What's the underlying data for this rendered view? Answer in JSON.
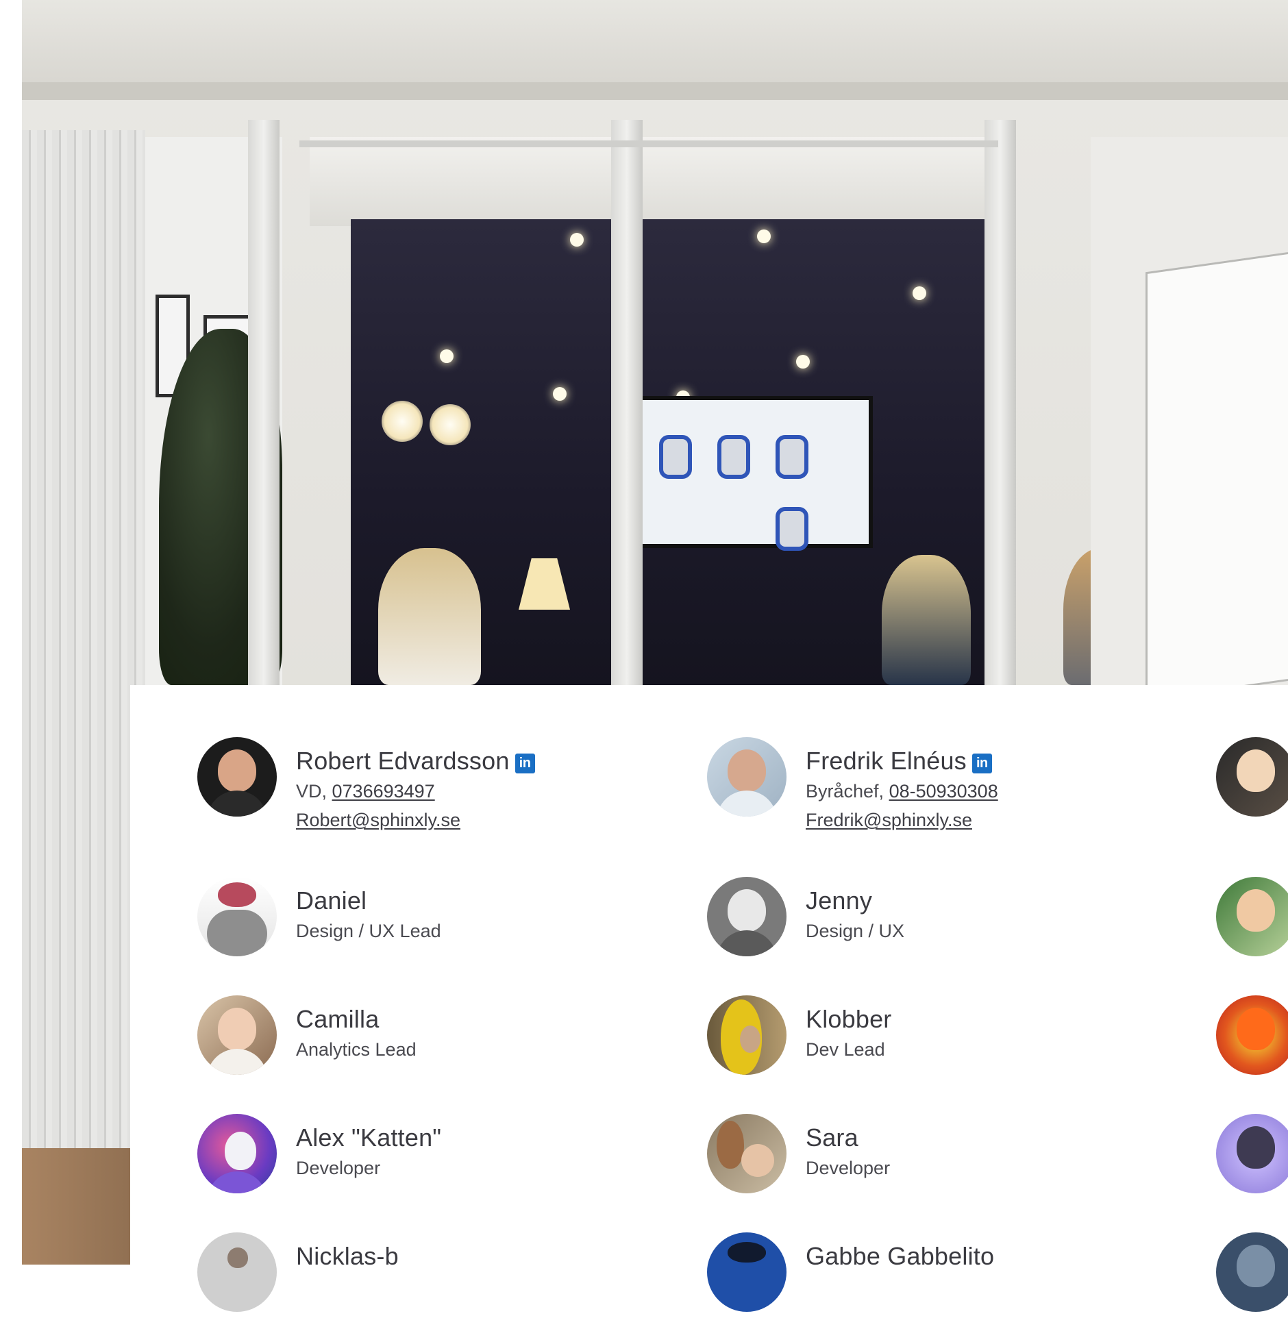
{
  "hero": {
    "image": "office-meeting-room-photo"
  },
  "colors": {
    "linkedin": "#1a6fc4",
    "text": "#3a3a40"
  },
  "icons": {
    "linkedin": "linkedin-icon"
  },
  "team": [
    {
      "name": "Robert Edvardsson",
      "role": "VD, ",
      "phone": "0736693497",
      "email": "Robert@sphinxly.se",
      "linkedin": "in"
    },
    {
      "name": "Fredrik Elnéus",
      "role": "Byråchef, ",
      "phone": "08-50930308",
      "email": "Fredrik@sphinxly.se",
      "linkedin": "in"
    },
    {
      "name": "Daniel",
      "role": "Design / UX Lead"
    },
    {
      "name": "Jenny",
      "role": "Design / UX"
    },
    {
      "name": "Camilla",
      "role": "Analytics Lead"
    },
    {
      "name": "Klobber",
      "role": "Dev Lead"
    },
    {
      "name": "Alex \"Katten\"",
      "role": "Developer"
    },
    {
      "name": "Sara",
      "role": "Developer"
    },
    {
      "name": "Nicklas-b",
      "role": ""
    },
    {
      "name": "Gabbe Gabbelito",
      "role": ""
    }
  ]
}
